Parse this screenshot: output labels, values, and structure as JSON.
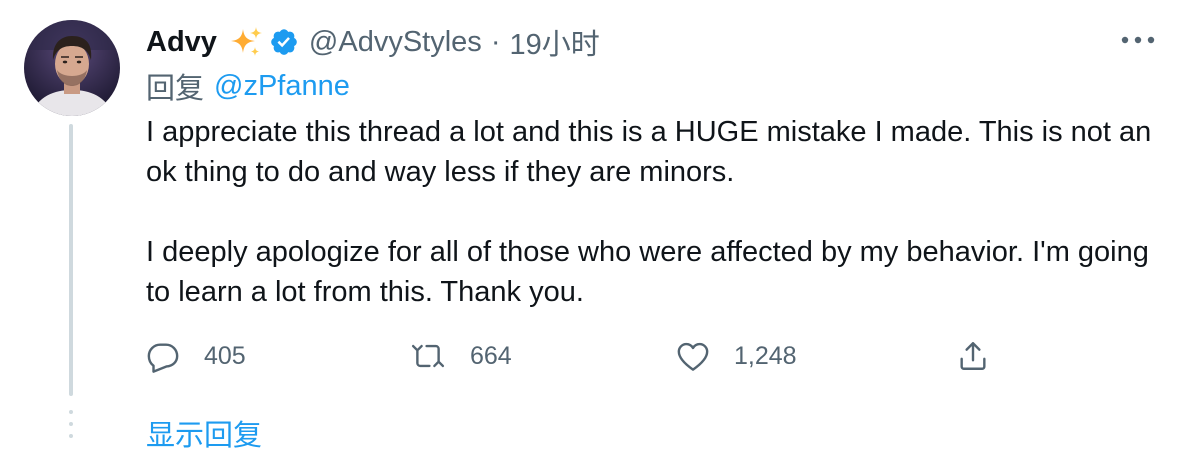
{
  "user": {
    "display_name": "Advy",
    "handle": "@AdvyStyles",
    "separator": "·",
    "time": "19小时",
    "avatar": "avatar",
    "name_emoji": "sparkles-icon",
    "verified": "verified-badge-icon"
  },
  "reply": {
    "prefix": "回复",
    "mention": "@zPfanne"
  },
  "tweet": {
    "paragraphs": [
      "I appreciate this thread a lot and this is a HUGE mistake I made. This is not an ok thing to do and way less if they are minors.",
      "I deeply apologize for all of those who were affected by my behavior. I'm going to learn a lot from this. Thank you."
    ]
  },
  "actions": {
    "reply_count": "405",
    "retweet_count": "664",
    "like_count": "1,248",
    "reply_icon": "reply-icon",
    "retweet_icon": "retweet-icon",
    "like_icon": "heart-icon",
    "share_icon": "share-icon"
  },
  "more_icon": "more-icon",
  "show_replies": "显示回复",
  "colors": {
    "accent": "#1d9bf0",
    "text": "#0f1419",
    "secondary": "#536471",
    "thread_line": "#cfd9de",
    "sparkle": "#ffac33"
  }
}
